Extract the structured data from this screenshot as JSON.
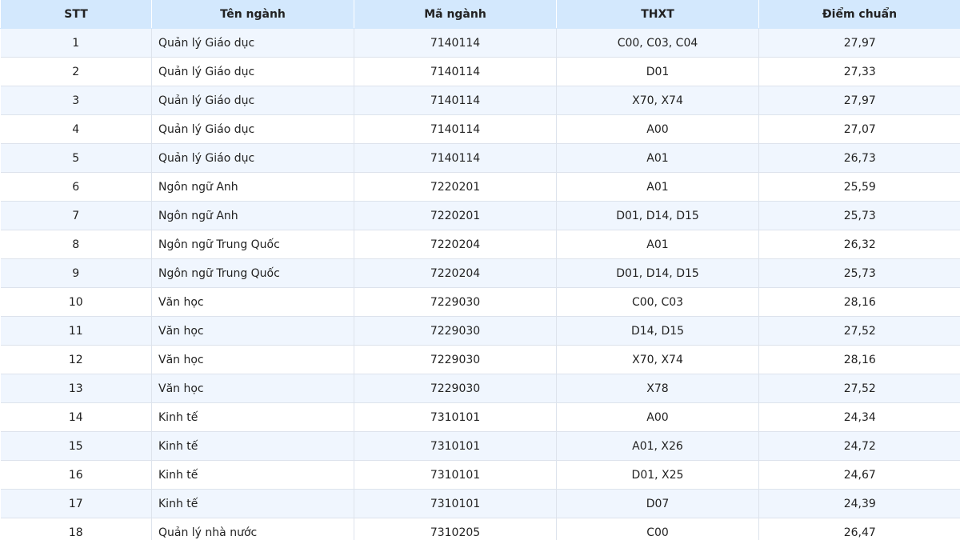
{
  "table": {
    "headers": [
      "STT",
      "Tên ngành",
      "Mã ngành",
      "THXT",
      "Điểm chuẩn"
    ],
    "rows": [
      [
        "1",
        "Quản lý Giáo dục",
        "7140114",
        "C00, C03, C04",
        "27,97"
      ],
      [
        "2",
        "Quản lý Giáo dục",
        "7140114",
        "D01",
        "27,33"
      ],
      [
        "3",
        "Quản lý Giáo dục",
        "7140114",
        "X70, X74",
        "27,97"
      ],
      [
        "4",
        "Quản lý Giáo dục",
        "7140114",
        "A00",
        "27,07"
      ],
      [
        "5",
        "Quản lý Giáo dục",
        "7140114",
        "A01",
        "26,73"
      ],
      [
        "6",
        "Ngôn ngữ Anh",
        "7220201",
        "A01",
        "25,59"
      ],
      [
        "7",
        "Ngôn ngữ Anh",
        "7220201",
        "D01, D14, D15",
        "25,73"
      ],
      [
        "8",
        "Ngôn ngữ Trung Quốc",
        "7220204",
        "A01",
        "26,32"
      ],
      [
        "9",
        "Ngôn ngữ Trung Quốc",
        "7220204",
        "D01, D14, D15",
        "25,73"
      ],
      [
        "10",
        "Văn học",
        "7229030",
        "C00, C03",
        "28,16"
      ],
      [
        "11",
        "Văn học",
        "7229030",
        "D14, D15",
        "27,52"
      ],
      [
        "12",
        "Văn học",
        "7229030",
        "X70, X74",
        "28,16"
      ],
      [
        "13",
        "Văn học",
        "7229030",
        "X78",
        "27,52"
      ],
      [
        "14",
        "Kinh tế",
        "7310101",
        "A00",
        "24,34"
      ],
      [
        "15",
        "Kinh tế",
        "7310101",
        "A01, X26",
        "24,72"
      ],
      [
        "16",
        "Kinh tế",
        "7310101",
        "D01, X25",
        "24,67"
      ],
      [
        "17",
        "Kinh tế",
        "7310101",
        "D07",
        "24,39"
      ],
      [
        "18",
        "Quản lý nhà nước",
        "7310205",
        "C00",
        "26,47"
      ]
    ]
  }
}
